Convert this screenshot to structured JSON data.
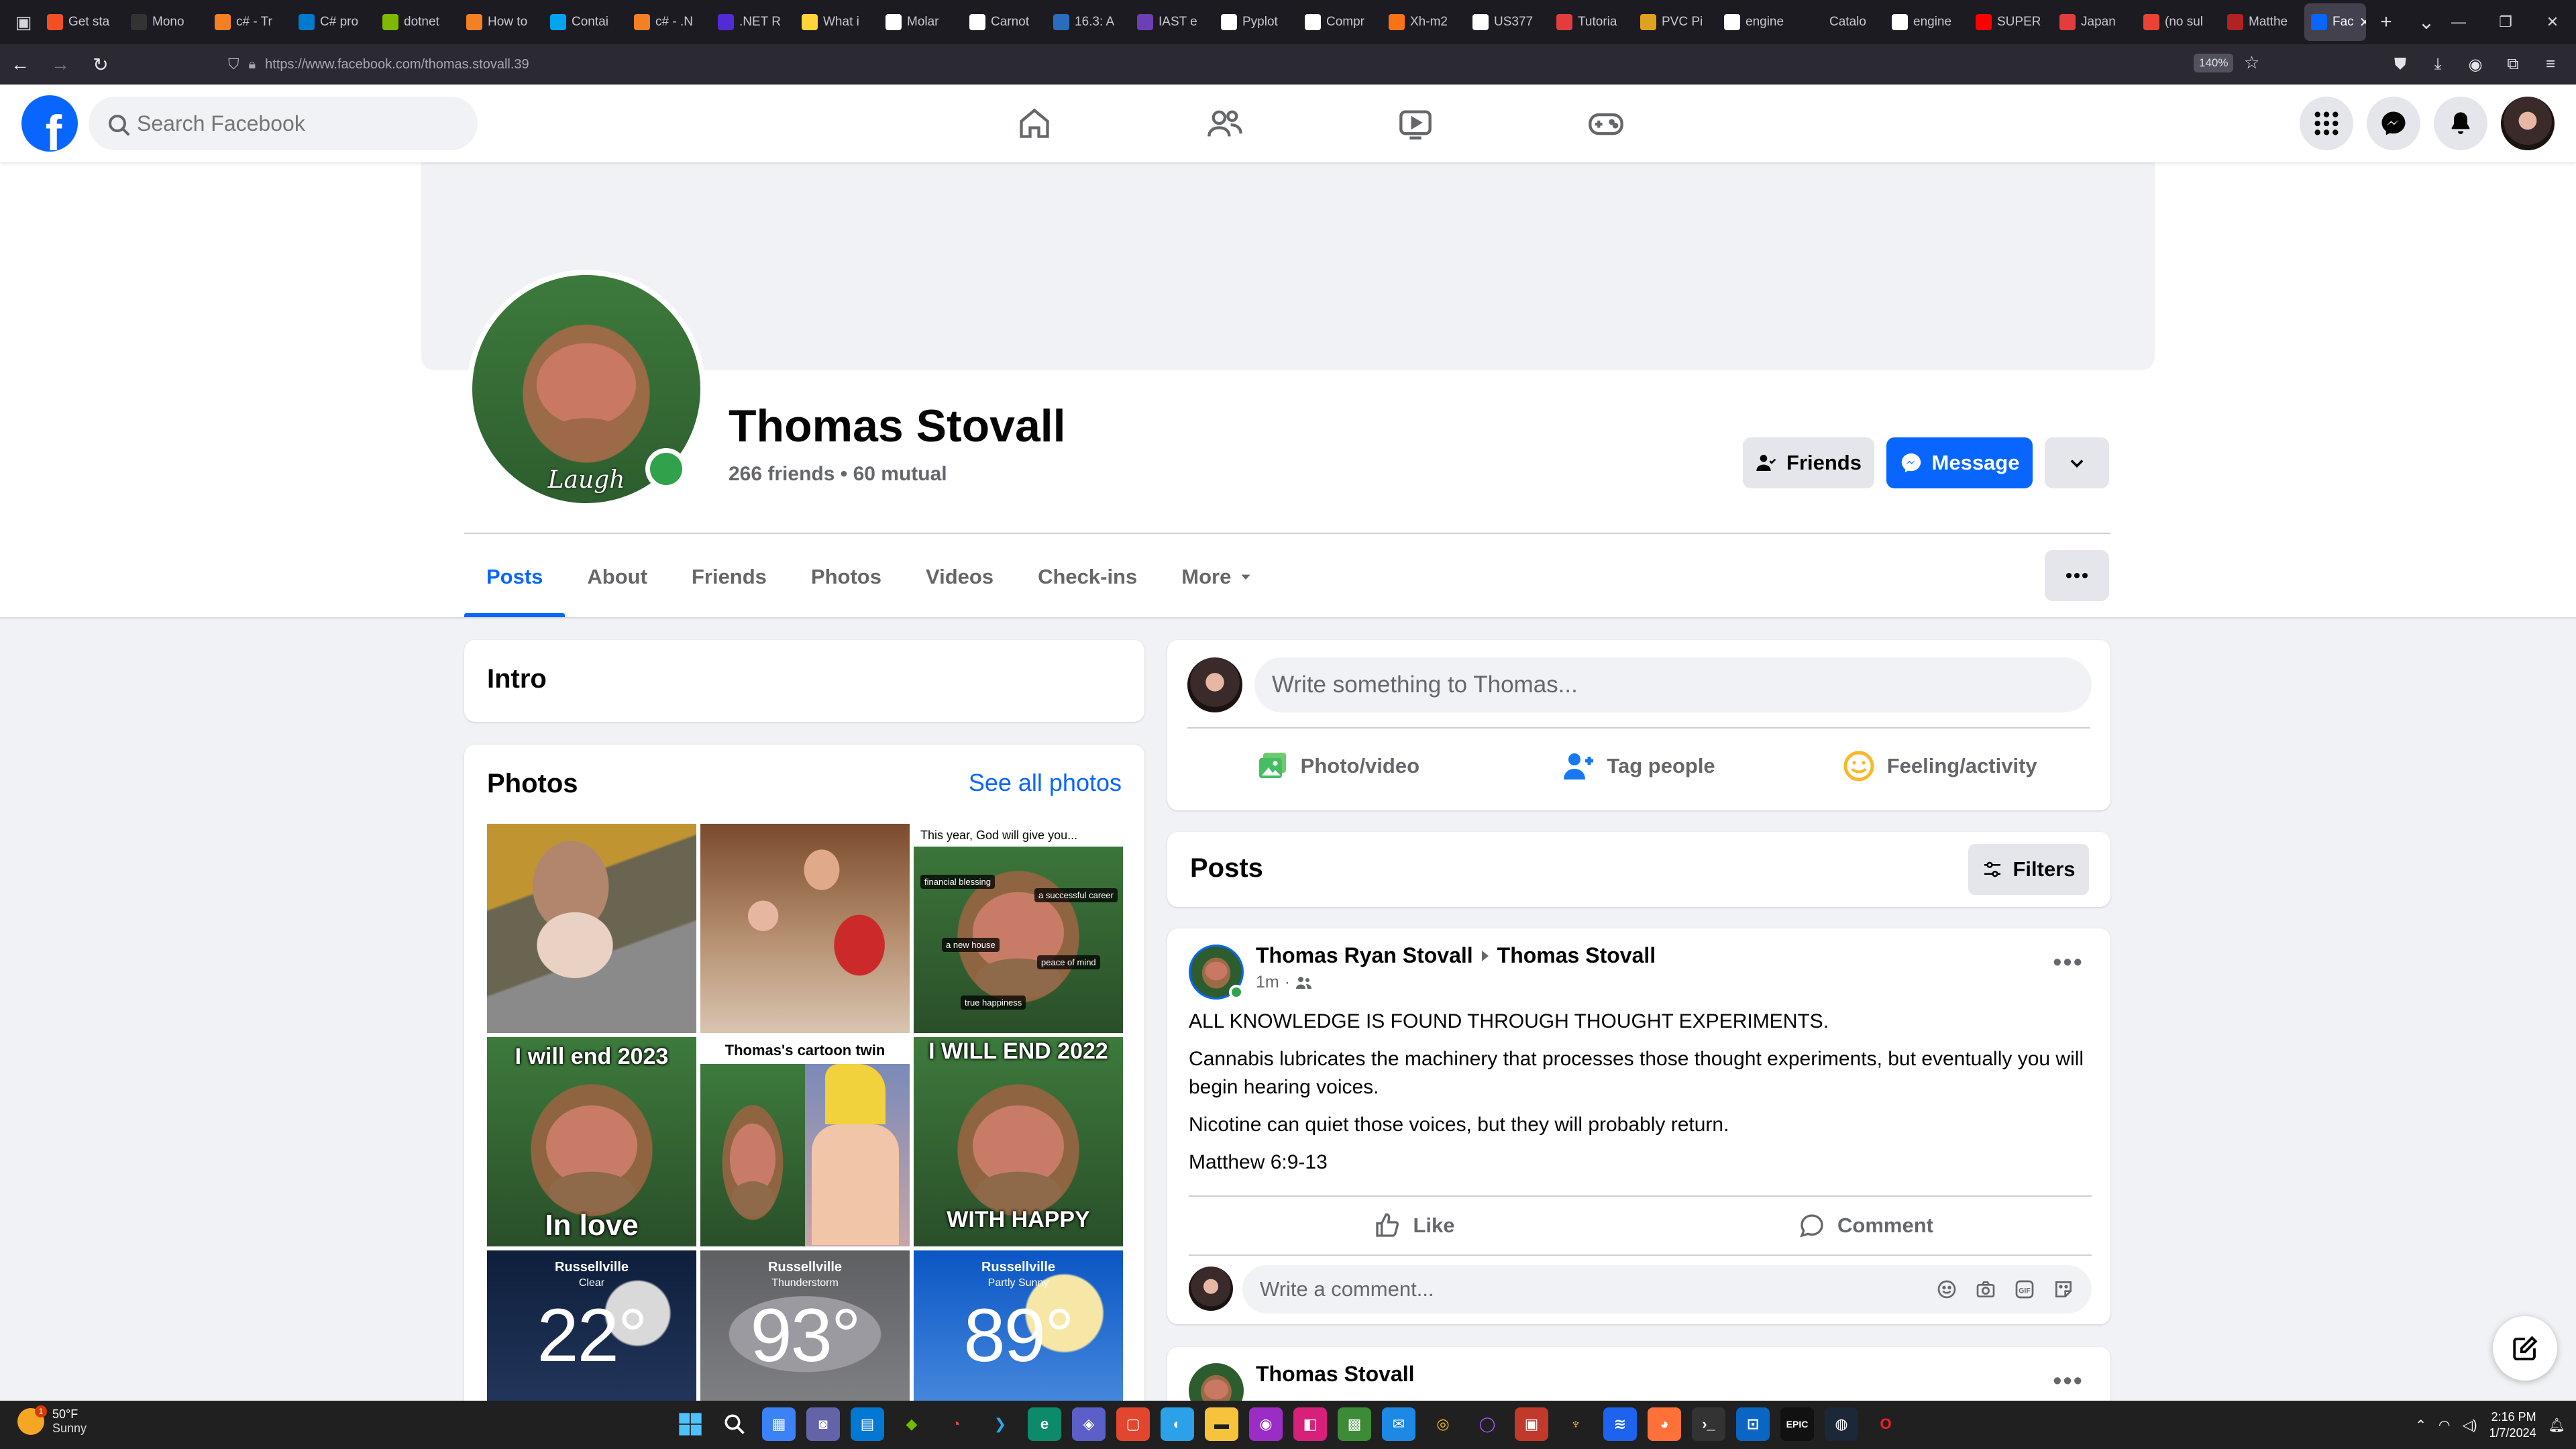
{
  "browser": {
    "tabs": [
      {
        "label": "Get sta",
        "color": "#f25022"
      },
      {
        "label": "Mono",
        "color": "#333333"
      },
      {
        "label": "c# - Tr",
        "color": "#f48024"
      },
      {
        "label": "C# pro",
        "color": "#007acc"
      },
      {
        "label": "dotnet",
        "color": "#7fba00"
      },
      {
        "label": "How to",
        "color": "#f48024"
      },
      {
        "label": "Contai",
        "color": "#00a4ef"
      },
      {
        "label": "c# - .N",
        "color": "#f48024"
      },
      {
        "label": ".NET R",
        "color": "#512bd4"
      },
      {
        "label": "What i",
        "color": "#ffd43b"
      },
      {
        "label": "Molar",
        "color": "#ffffff"
      },
      {
        "label": "Carnot",
        "color": "#ffffff"
      },
      {
        "label": "16.3: A",
        "color": "#2a6ebb"
      },
      {
        "label": "IAST e",
        "color": "#6c3fb5"
      },
      {
        "label": "Pyplot",
        "color": "#ffffff"
      },
      {
        "label": "Compr",
        "color": "#ffffff"
      },
      {
        "label": "Xh-m2",
        "color": "#f97316"
      },
      {
        "label": "US377",
        "color": "#ffffff"
      },
      {
        "label": "Tutoria",
        "color": "#e23d3d"
      },
      {
        "label": "PVC Pi",
        "color": "#e0a020"
      },
      {
        "label": "engine",
        "color": "#ffffff"
      },
      {
        "label": "Catalo",
        "color": "#1c1b22"
      },
      {
        "label": "engine",
        "color": "#ffffff"
      },
      {
        "label": "SUPER",
        "color": "#ff0000"
      },
      {
        "label": "Japan",
        "color": "#e23d3d"
      },
      {
        "label": "(no sul",
        "color": "#ea4335"
      },
      {
        "label": "Matthe",
        "color": "#b22222"
      }
    ],
    "active_tab": {
      "label": "Fac",
      "color": "#0866ff"
    },
    "url": "https://www.facebook.com/thomas.stovall.39",
    "zoom": "140%"
  },
  "header": {
    "logo": "f",
    "search_placeholder": "Search Facebook",
    "nav": [
      "home-icon",
      "friends-icon",
      "watch-icon",
      "gaming-icon"
    ],
    "right": [
      "menu-grid-icon",
      "messenger-icon",
      "notifications-bell-icon",
      "profile-avatar"
    ]
  },
  "profile": {
    "name": "Thomas Stovall",
    "subline": "266 friends • 60 mutual",
    "picture_caption": "Laugh",
    "buttons": {
      "friends": "Friends",
      "message": "Message"
    },
    "tabs": [
      "Posts",
      "About",
      "Friends",
      "Photos",
      "Videos",
      "Check-ins",
      "More"
    ],
    "active_tab": "Posts"
  },
  "intro": {
    "title": "Intro"
  },
  "photos": {
    "title": "Photos",
    "see_all": "See all photos",
    "god_caption": "This year, God will give you...",
    "god_tags": [
      "financial blessing",
      "a successful career",
      "a new house",
      "peace of mind",
      "true happiness"
    ],
    "meme_2023_top": "I will end 2023",
    "meme_2023_bottom": "In love",
    "cartoon_caption": "Thomas's cartoon twin",
    "meme_2022_top": "I WILL END 2022",
    "meme_2022_bottom": "WITH HAPPY",
    "weather": [
      {
        "city": "Russellville",
        "cond": "Clear",
        "temp": "22°"
      },
      {
        "city": "Russellville",
        "cond": "Thunderstorm",
        "temp": "93°"
      },
      {
        "city": "Russellville",
        "cond": "Partly Sunny",
        "temp": "89°"
      }
    ]
  },
  "composer": {
    "placeholder": "Write something to Thomas...",
    "actions": [
      "Photo/video",
      "Tag people",
      "Feeling/activity"
    ]
  },
  "posts_section": {
    "title": "Posts",
    "filters": "Filters"
  },
  "post": {
    "author": "Thomas Ryan Stovall",
    "target": "Thomas Stovall",
    "time": "1m",
    "paragraphs": [
      "ALL KNOWLEDGE IS FOUND THROUGH THOUGHT EXPERIMENTS.",
      "Cannabis lubricates the machinery that processes those thought experiments, but eventually you will begin hearing voices.",
      "Nicotine can quiet those voices, but they will probably return.",
      "Matthew 6:9-13"
    ],
    "like": "Like",
    "comment": "Comment",
    "comment_placeholder": "Write a comment..."
  },
  "post2": {
    "author": "Thomas Stovall"
  },
  "taskbar": {
    "weather_temp": "50°F",
    "weather_cond": "Sunny",
    "time": "2:16 PM",
    "date": "1/7/2024"
  }
}
